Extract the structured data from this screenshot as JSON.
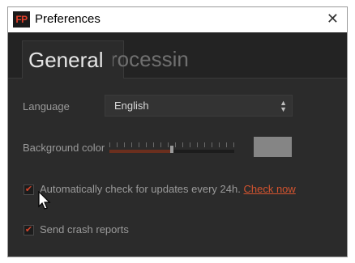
{
  "window": {
    "logo_text": "FP",
    "title": "Preferences",
    "close_glyph": "✕"
  },
  "tabs": [
    {
      "label": "General",
      "active": true
    },
    {
      "label": "rocessin",
      "active": false
    }
  ],
  "language": {
    "label": "Language",
    "value": "English"
  },
  "background": {
    "label": "Background color",
    "slider_level": 0.5,
    "swatch_color": "#858585"
  },
  "updates": {
    "checked": true,
    "check_glyph": "✔",
    "text": "Automatically check for updates every 24h.",
    "link": "Check now"
  },
  "crash": {
    "checked": true,
    "check_glyph": "✔",
    "text": "Send crash reports"
  },
  "colors": {
    "accent": "#d2532f",
    "panel": "#2b2b2b"
  },
  "icons": {
    "close": "close-icon",
    "cursor": "mouse-pointer-icon",
    "select_arrows": "updown-arrows-icon"
  }
}
